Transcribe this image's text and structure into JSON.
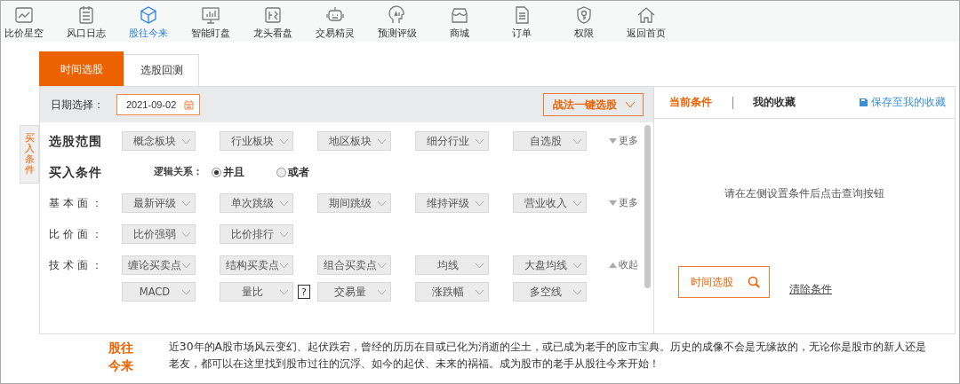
{
  "nav": {
    "items": [
      {
        "label": "比价星空",
        "selected": false
      },
      {
        "label": "风口日志",
        "selected": false
      },
      {
        "label": "股往今来",
        "selected": true
      },
      {
        "label": "智能盯盘",
        "selected": false
      },
      {
        "label": "龙头看盘",
        "selected": false
      },
      {
        "label": "交易精灵",
        "selected": false
      },
      {
        "label": "预测评级",
        "selected": false
      },
      {
        "label": "商城",
        "selected": false
      },
      {
        "label": "订单",
        "selected": false
      },
      {
        "label": "权限",
        "selected": false
      },
      {
        "label": "返回首页",
        "selected": false
      }
    ]
  },
  "tabs": [
    {
      "label": "时间选股",
      "selected": true
    },
    {
      "label": "选股回测",
      "selected": false
    }
  ],
  "filter": {
    "date_label": "日期选择：",
    "date_value": "2021-09-02",
    "strategy_button": "战法一键选股"
  },
  "side_tab": "买入条件",
  "sections": [
    {
      "kind": "range",
      "label": "选股范围",
      "rows": [
        [
          {
            "label": "概念板块"
          },
          {
            "label": "行业板块"
          },
          {
            "label": "地区板块"
          },
          {
            "label": "细分行业"
          },
          {
            "label": "自选股"
          }
        ]
      ],
      "toggle": {
        "label": "更多",
        "expanded": false
      }
    },
    {
      "kind": "logic",
      "label": "买入条件",
      "logic_label": "逻辑关系：",
      "options": [
        {
          "label": "并且",
          "selected": true
        },
        {
          "label": "或者",
          "selected": false
        }
      ]
    },
    {
      "kind": "group",
      "label": "基本面：",
      "rows": [
        [
          {
            "label": "最新评级"
          },
          {
            "label": "单次跳级"
          },
          {
            "label": "期间跳级"
          },
          {
            "label": "维持评级"
          },
          {
            "label": "营业收入"
          }
        ]
      ],
      "toggle": {
        "label": "更多",
        "expanded": false
      }
    },
    {
      "kind": "group",
      "label": "比价面：",
      "rows": [
        [
          {
            "label": "比价强弱"
          },
          {
            "label": "比价排行"
          }
        ]
      ]
    },
    {
      "kind": "group",
      "label": "技术面：",
      "rows": [
        [
          {
            "label": "缠论买卖点"
          },
          {
            "label": "结构买卖点"
          },
          {
            "label": "组合买卖点"
          },
          {
            "label": "均线"
          },
          {
            "label": "大盘均线"
          }
        ],
        [
          {
            "label": "MACD"
          },
          {
            "label": "量比",
            "help": "?"
          },
          {
            "label": "交易量"
          },
          {
            "label": "涨跌幅"
          },
          {
            "label": "多空线"
          }
        ]
      ],
      "toggle": {
        "label": "收起",
        "expanded": true
      }
    }
  ],
  "right": {
    "tabs": [
      {
        "label": "当前条件",
        "selected": true
      },
      {
        "label": "我的收藏",
        "selected": false
      }
    ],
    "save_link": "保存至我的收藏",
    "empty_message": "请在左侧设置条件后点击查询按钮",
    "search_button": "时间选股",
    "clear_link": "清除条件"
  },
  "footer": {
    "title": "股往今来",
    "text": "近30年的A股市场风云变幻、起伏跌宕，曾经的历历在目或已化为消逝的尘土，或已成为老手的应市宝典。历史的成像不会是无缘故的，无论你是股市的新人还是老友，都可以在这里找到股市过往的沉浮、如今的起伏、未来的祸福。成为股市的老手从股往今来开始！"
  }
}
